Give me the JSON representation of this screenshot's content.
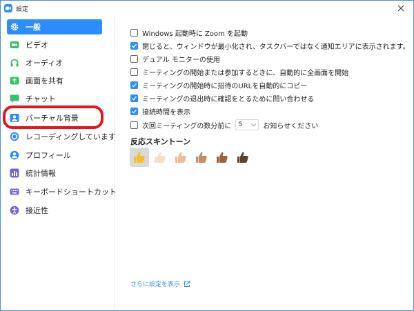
{
  "window": {
    "title": "設定"
  },
  "sidebar": {
    "items": [
      {
        "label": "一般",
        "icon": "gear-icon",
        "active": true
      },
      {
        "label": "ビデオ",
        "icon": "video-icon"
      },
      {
        "label": "オーディオ",
        "icon": "headphones-icon"
      },
      {
        "label": "画面を共有",
        "icon": "share-screen-icon"
      },
      {
        "label": "チャット",
        "icon": "chat-icon"
      },
      {
        "label": "バーチャル背景",
        "icon": "virtual-background-icon"
      },
      {
        "label": "レコーディングしています",
        "icon": "record-icon"
      },
      {
        "label": "プロフィール",
        "icon": "profile-icon"
      },
      {
        "label": "統計情報",
        "icon": "statistics-icon"
      },
      {
        "label": "キーボードショートカット",
        "icon": "keyboard-icon"
      },
      {
        "label": "接近性",
        "icon": "accessibility-icon"
      }
    ]
  },
  "general": {
    "options": [
      {
        "label": "Windows 起動時に Zoom を起動",
        "checked": false
      },
      {
        "label": "閉じると、ウィンドウが最小化され、タスクバーではなく通知エリアに表示されます。",
        "checked": true
      },
      {
        "label": "デュアル モニターの使用",
        "checked": false
      },
      {
        "label": "ミーティングの開始または参加するときに、自動的に全画面を開始",
        "checked": false
      },
      {
        "label": "ミーティングの開始時に招待のURLを自動的にコピー",
        "checked": true
      },
      {
        "label": "ミーティングの退出時に確認をとるために問い合わせる",
        "checked": true
      },
      {
        "label": "接続時間を表示",
        "checked": true
      }
    ],
    "reminder": {
      "prefix": "次回ミーティングの数分前に",
      "value": "5",
      "suffix": "お知らせください",
      "checked": false
    },
    "skin_tone": {
      "title": "反応スキントーン",
      "tones": [
        "#f5c026",
        "#f7dcc4",
        "#e7bd9b",
        "#c48e64",
        "#976341",
        "#5e4130"
      ],
      "selected_index": 0
    },
    "more_settings_link": "さらに設定を表示"
  },
  "colors": {
    "accent": "#2d8cff",
    "highlight": "#e8141d"
  }
}
